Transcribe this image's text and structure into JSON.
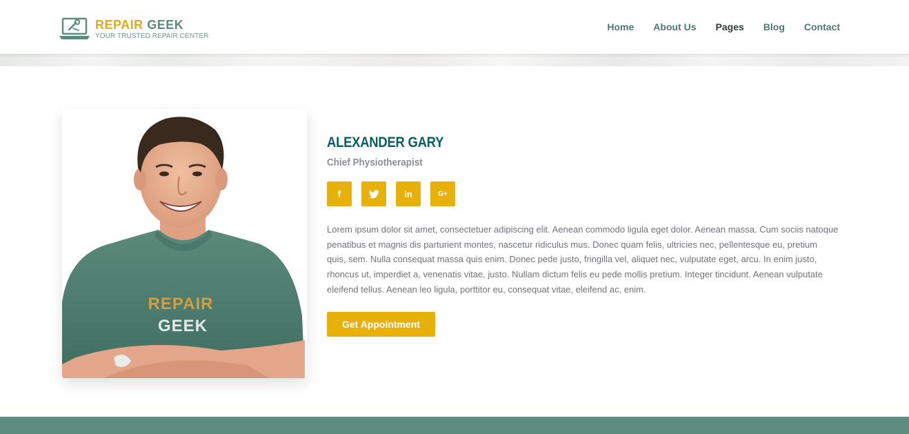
{
  "brand": {
    "title_part1": "REPAIR",
    "title_part2": "GEEK",
    "tagline": "YOUR TRUSTED REPAIR CENTER",
    "accent_color": "#e6a912",
    "secondary_color": "#5a8c7e",
    "logo_icon": "laptop-wrench-icon"
  },
  "nav": {
    "items": [
      {
        "label": "Home",
        "active": false
      },
      {
        "label": "About Us",
        "active": false
      },
      {
        "label": "Pages",
        "active": true
      },
      {
        "label": "Blog",
        "active": false
      },
      {
        "label": "Contact",
        "active": false
      }
    ]
  },
  "profile": {
    "name": "ALEXANDER GARY",
    "role": "Chief Physiotherapist",
    "shirt_text_line1": "REPAIR",
    "shirt_text_line2": "GEEK",
    "socials": [
      {
        "icon": "facebook-icon",
        "glyph": "f"
      },
      {
        "icon": "twitter-icon",
        "glyph": "t"
      },
      {
        "icon": "linkedin-icon",
        "glyph": "in"
      },
      {
        "icon": "google-plus-icon",
        "glyph": "G+"
      }
    ],
    "bio": "Lorem ipsum dolor sit amet, consectetuer adipiscing elit. Aenean commodo ligula eget dolor. Aenean massa. Cum sociis natoque penatibus et magnis dis parturient montes, nascetur ridiculus mus. Donec quam felis, ultricies nec, pellentesque eu, pretium quis, sem. Nulla consequat massa quis enim. Donec pede justo, fringilla vel, aliquet nec, vulputate eget, arcu. In enim justo, rhoncus ut, imperdiet a, venenatis vitae, justo. Nullam dictum felis eu pede mollis pretium. Integer tincidunt. Aenean vulputate eleifend tellus. Aenean leo ligula, porttitor eu, consequat vitae, eleifend ac, enim.",
    "cta_label": "Get Appointment",
    "button_color": "#e8b10a",
    "name_color": "#0b5e5f"
  },
  "footer": {
    "band_color": "#5e8c80"
  }
}
